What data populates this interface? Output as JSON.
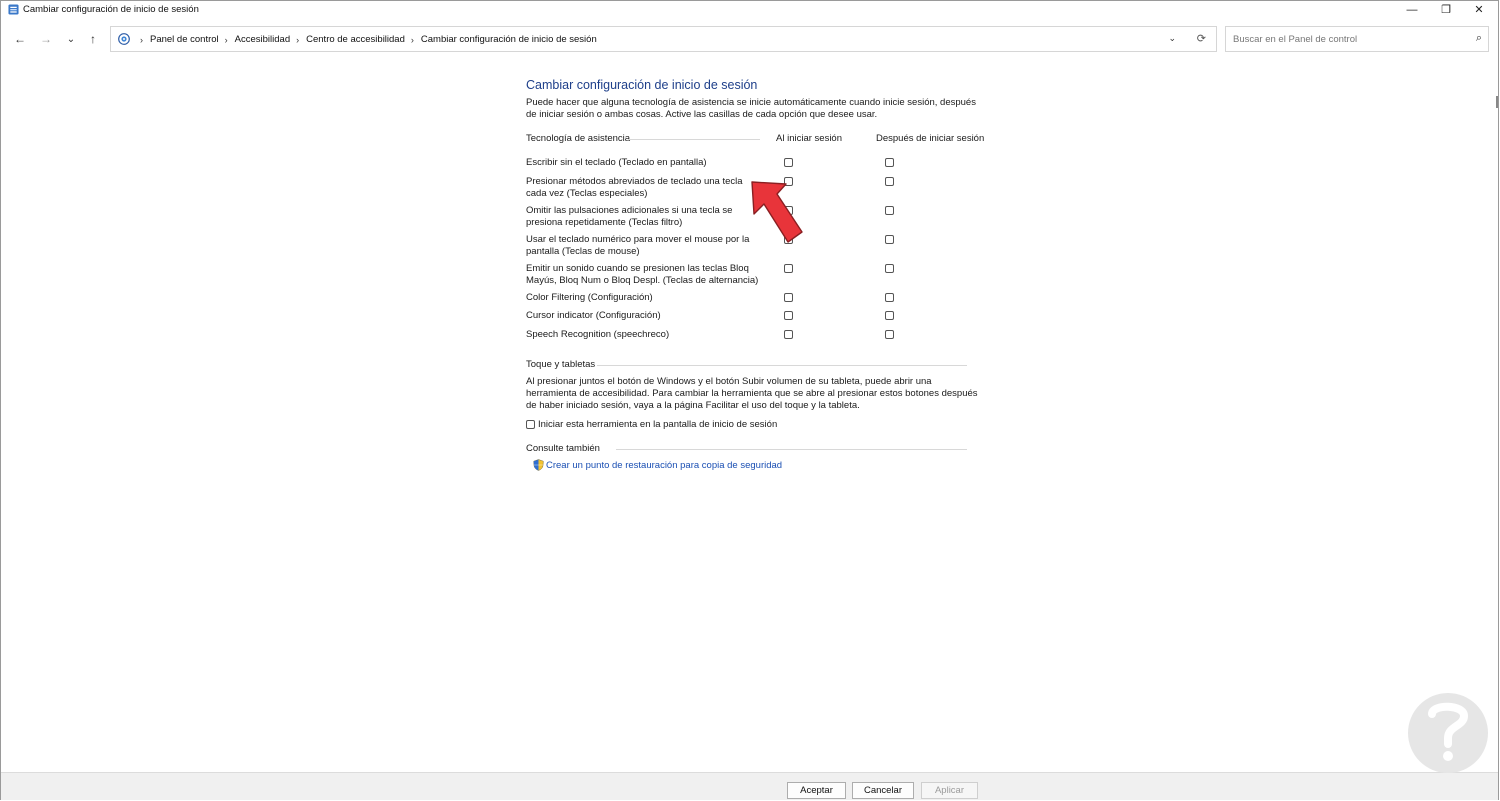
{
  "window": {
    "title": "Cambiar configuración de inicio de sesión",
    "minimize_glyph": "—",
    "maximize_glyph": "❐",
    "close_glyph": "✕"
  },
  "nav": {
    "back_glyph": "←",
    "forward_glyph": "→",
    "recent_glyph": "⌄",
    "up_glyph": "↑",
    "breadcrumbs": [
      "Panel de control",
      "Accesibilidad",
      "Centro de accesibilidad",
      "Cambiar configuración de inicio de sesión"
    ],
    "dropdown_glyph": "⌄",
    "refresh_glyph": "⟳",
    "search_placeholder": "Buscar en el Panel de control",
    "search_glyph": "⌕"
  },
  "main": {
    "title": "Cambiar configuración de inicio de sesión",
    "description": "Puede hacer que alguna tecnología de asistencia se inicie automáticamente cuando inicie sesión, después de iniciar sesión o ambas cosas. Active las casillas de cada opción que desee usar.",
    "columns": {
      "technology": "Tecnología de asistencia",
      "at_signin": "Al iniciar sesión",
      "after_signin": "Después de iniciar sesión"
    },
    "rows": [
      {
        "label": "Escribir sin el teclado (Teclado en pantalla)",
        "at_signin": false,
        "after_signin": false
      },
      {
        "label": "Presionar métodos abreviados de teclado una tecla cada vez (Teclas especiales)",
        "at_signin": false,
        "after_signin": false
      },
      {
        "label": "Omitir las pulsaciones adicionales si una tecla se presiona repetidamente (Teclas filtro)",
        "at_signin": false,
        "after_signin": false
      },
      {
        "label": "Usar el teclado numérico para mover el mouse por la pantalla (Teclas de mouse)",
        "at_signin": false,
        "after_signin": false
      },
      {
        "label": "Emitir un sonido cuando se presionen las teclas Bloq Mayús, Bloq Num o Bloq Despl. (Teclas de alternancia)",
        "at_signin": false,
        "after_signin": false
      },
      {
        "label": "Color Filtering (Configuración)",
        "at_signin": false,
        "after_signin": false
      },
      {
        "label": "Cursor indicator (Configuración)",
        "at_signin": false,
        "after_signin": false
      },
      {
        "label": "Speech Recognition (speechreco)",
        "at_signin": false,
        "after_signin": false
      }
    ],
    "touch": {
      "title": "Toque y tabletas",
      "description": "Al presionar juntos el botón de Windows y el botón Subir volumen de su tableta, puede abrir una herramienta de accesibilidad. Para cambiar la herramienta que se abre al presionar estos botones después de haber iniciado sesión, vaya a la página Facilitar el uso del toque y la tableta.",
      "checkbox_label": "Iniciar esta herramienta en la pantalla de inicio de sesión",
      "checked": false
    },
    "see_also": {
      "title": "Consulte también",
      "link": "Crear un punto de restauración para copia de seguridad"
    }
  },
  "buttons": {
    "ok": "Aceptar",
    "cancel": "Cancelar",
    "apply": "Aplicar"
  },
  "colors": {
    "heading": "#1e3f8a",
    "link": "#1a4fb3",
    "annotation_arrow": "#e8343a"
  }
}
